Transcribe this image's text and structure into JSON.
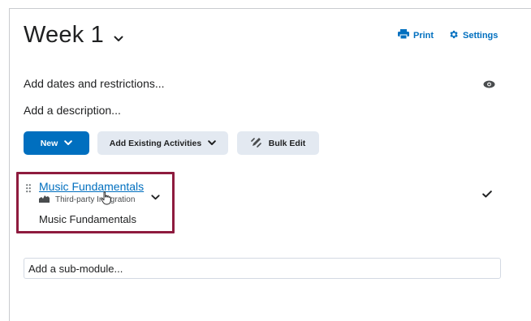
{
  "header": {
    "title": "Week 1",
    "print_label": "Print",
    "settings_label": "Settings"
  },
  "module": {
    "dates_text": "Add dates and restrictions...",
    "description_text": "Add a description..."
  },
  "toolbar": {
    "new_label": "New",
    "add_existing_label": "Add Existing Activities",
    "bulk_edit_label": "Bulk Edit"
  },
  "item": {
    "title": "Music Fundamentals",
    "type_label": "Third-party Integration",
    "description": "Music Fundamentals"
  },
  "submodule": {
    "placeholder": "Add a sub-module..."
  },
  "colors": {
    "accent": "#006fbf",
    "highlight_border": "#8e1b3e",
    "secondary_button": "#e3e9f1"
  }
}
